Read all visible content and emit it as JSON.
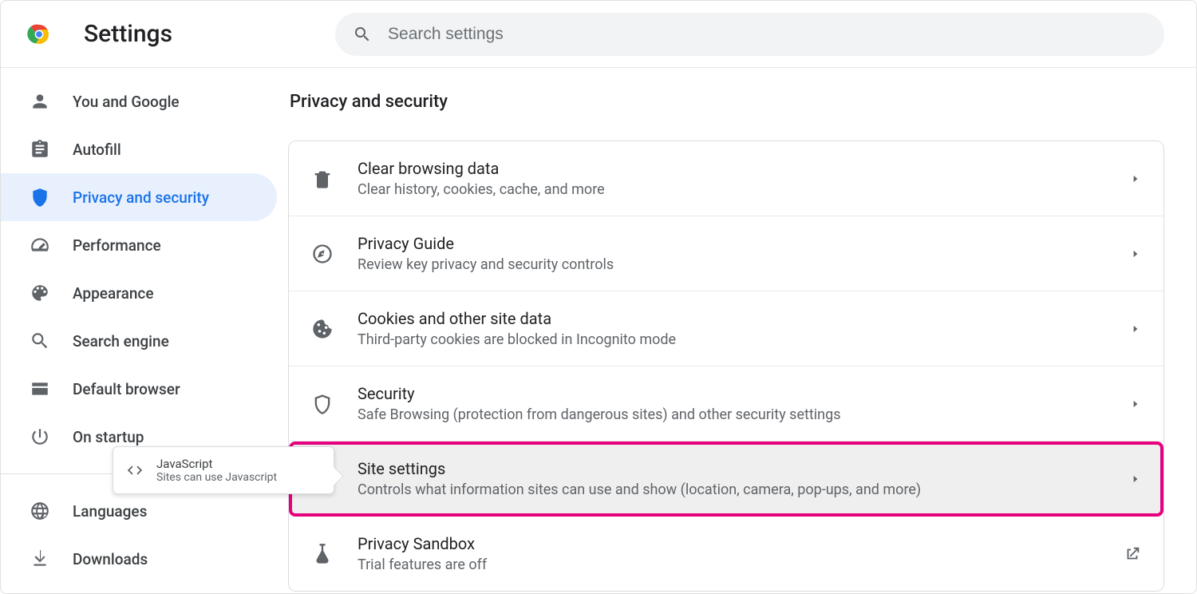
{
  "header": {
    "title": "Settings",
    "search_placeholder": "Search settings"
  },
  "sidebar": {
    "items": [
      {
        "icon": "person-icon",
        "label": "You and Google",
        "active": false
      },
      {
        "icon": "clipboard-icon",
        "label": "Autofill",
        "active": false
      },
      {
        "icon": "shield-icon",
        "label": "Privacy and security",
        "active": true
      },
      {
        "icon": "tachometer-icon",
        "label": "Performance",
        "active": false
      },
      {
        "icon": "palette-icon",
        "label": "Appearance",
        "active": false
      },
      {
        "icon": "search-icon",
        "label": "Search engine",
        "active": false
      },
      {
        "icon": "browser-icon",
        "label": "Default browser",
        "active": false
      },
      {
        "icon": "power-icon",
        "label": "On startup",
        "active": false
      }
    ],
    "items2": [
      {
        "icon": "globe-icon",
        "label": "Languages"
      },
      {
        "icon": "download-icon",
        "label": "Downloads"
      }
    ]
  },
  "section_title": "Privacy and security",
  "rows": [
    {
      "icon": "trash-icon",
      "title": "Clear browsing data",
      "sub": "Clear history, cookies, cache, and more",
      "trailing": "chevron"
    },
    {
      "icon": "compass-icon",
      "title": "Privacy Guide",
      "sub": "Review key privacy and security controls",
      "trailing": "chevron"
    },
    {
      "icon": "cookie-icon",
      "title": "Cookies and other site data",
      "sub": "Third-party cookies are blocked in Incognito mode",
      "trailing": "chevron"
    },
    {
      "icon": "shield-outline-icon",
      "title": "Security",
      "sub": "Safe Browsing (protection from dangerous sites) and other security settings",
      "trailing": "chevron"
    },
    {
      "icon": "tune-icon",
      "title": "Site settings",
      "sub": "Controls what information sites can use and show (location, camera, pop-ups, and more)",
      "trailing": "chevron",
      "highlight": true
    },
    {
      "icon": "flask-icon",
      "title": "Privacy Sandbox",
      "sub": "Trial features are off",
      "trailing": "open"
    }
  ],
  "tooltip": {
    "title": "JavaScript",
    "sub": "Sites can use Javascript"
  }
}
